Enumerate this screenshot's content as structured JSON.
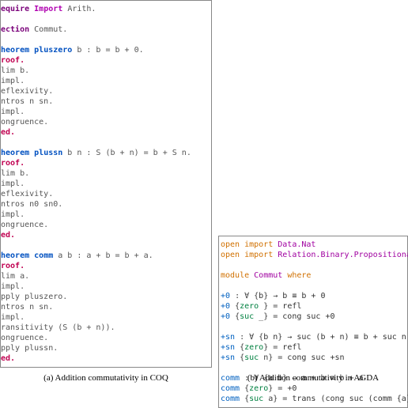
{
  "captions": {
    "a": "(a) Addition commutativity in COQ",
    "b": "(b) Addition commutativity in AGDA"
  },
  "coq": {
    "lines": [
      {
        "t": [
          [
            "cq-kw",
            "equire"
          ],
          [
            "cq-punct",
            " "
          ],
          [
            "cq-kw2",
            "Import"
          ],
          [
            "cq-punct",
            " "
          ],
          [
            "cq-body",
            "Arith."
          ]
        ]
      },
      {
        "t": [
          [
            "",
            ""
          ]
        ]
      },
      {
        "t": [
          [
            "cq-sec",
            "ection"
          ],
          [
            "cq-punct",
            " "
          ],
          [
            "cq-body",
            "Commut."
          ]
        ]
      },
      {
        "t": [
          [
            "",
            ""
          ]
        ]
      },
      {
        "t": [
          [
            "cq-thm",
            "heorem"
          ],
          [
            "cq-punct",
            " "
          ],
          [
            "cq-thm",
            "pluszero"
          ],
          [
            "cq-body",
            " b : b = b + 0."
          ]
        ]
      },
      {
        "t": [
          [
            "cq-proof",
            "roof."
          ]
        ]
      },
      {
        "t": [
          [
            "cq-body",
            "lim b."
          ]
        ]
      },
      {
        "t": [
          [
            "cq-body",
            "impl."
          ]
        ]
      },
      {
        "t": [
          [
            "cq-body",
            "eflexivity."
          ]
        ]
      },
      {
        "t": [
          [
            "cq-body",
            "ntros n sn."
          ]
        ]
      },
      {
        "t": [
          [
            "cq-body",
            "impl."
          ]
        ]
      },
      {
        "t": [
          [
            "cq-body",
            "ongruence."
          ]
        ]
      },
      {
        "t": [
          [
            "cq-qed",
            "ed."
          ]
        ]
      },
      {
        "t": [
          [
            "",
            ""
          ]
        ]
      },
      {
        "t": [
          [
            "cq-thm",
            "heorem"
          ],
          [
            "cq-punct",
            " "
          ],
          [
            "cq-thm",
            "plussn"
          ],
          [
            "cq-body",
            " b n : S (b + n) = b + S n."
          ]
        ]
      },
      {
        "t": [
          [
            "cq-proof",
            "roof."
          ]
        ]
      },
      {
        "t": [
          [
            "cq-body",
            "lim b."
          ]
        ]
      },
      {
        "t": [
          [
            "cq-body",
            "impl."
          ]
        ]
      },
      {
        "t": [
          [
            "cq-body",
            "eflexivity."
          ]
        ]
      },
      {
        "t": [
          [
            "cq-body",
            "ntros n0 sn0."
          ]
        ]
      },
      {
        "t": [
          [
            "cq-body",
            "impl."
          ]
        ]
      },
      {
        "t": [
          [
            "cq-body",
            "ongruence."
          ]
        ]
      },
      {
        "t": [
          [
            "cq-qed",
            "ed."
          ]
        ]
      },
      {
        "t": [
          [
            "",
            ""
          ]
        ]
      },
      {
        "t": [
          [
            "cq-thm",
            "heorem"
          ],
          [
            "cq-punct",
            " "
          ],
          [
            "cq-thm",
            "comm"
          ],
          [
            "cq-body",
            " a b : a + b = b + a."
          ]
        ]
      },
      {
        "t": [
          [
            "cq-proof",
            "roof."
          ]
        ]
      },
      {
        "t": [
          [
            "cq-body",
            "lim a."
          ]
        ]
      },
      {
        "t": [
          [
            "cq-body",
            "impl."
          ]
        ]
      },
      {
        "t": [
          [
            "cq-body",
            "pply pluszero."
          ]
        ]
      },
      {
        "t": [
          [
            "cq-body",
            "ntros n sn."
          ]
        ]
      },
      {
        "t": [
          [
            "cq-body",
            "impl."
          ]
        ]
      },
      {
        "t": [
          [
            "cq-body",
            "ransitivity (S (b + n))."
          ]
        ]
      },
      {
        "t": [
          [
            "cq-body",
            "ongruence."
          ]
        ]
      },
      {
        "t": [
          [
            "cq-body",
            "pply plussn."
          ]
        ]
      },
      {
        "t": [
          [
            "cq-qed",
            "ed."
          ]
        ]
      }
    ]
  },
  "agda": {
    "lines": [
      {
        "t": [
          [
            "ag-kw",
            "open import"
          ],
          [
            "ag-punct",
            " "
          ],
          [
            "ag-mod",
            "Data.Nat"
          ]
        ]
      },
      {
        "t": [
          [
            "ag-kw",
            "open import"
          ],
          [
            "ag-punct",
            " "
          ],
          [
            "ag-mod",
            "Relation.Binary.PropositionalEquality"
          ]
        ]
      },
      {
        "t": [
          [
            "",
            ""
          ]
        ]
      },
      {
        "t": [
          [
            "ag-kw",
            "module"
          ],
          [
            "ag-punct",
            " "
          ],
          [
            "ag-mod",
            "Commut"
          ],
          [
            "ag-punct",
            " "
          ],
          [
            "ag-kw",
            "where"
          ]
        ]
      },
      {
        "t": [
          [
            "",
            ""
          ]
        ]
      },
      {
        "t": [
          [
            "ag-id",
            "+0"
          ],
          [
            "ag-punct",
            " : ∀ {"
          ],
          [
            "ag-body",
            "b"
          ],
          [
            "ag-punct",
            "} → "
          ],
          [
            "ag-body",
            "b ≡ b + 0"
          ]
        ]
      },
      {
        "t": [
          [
            "ag-id",
            "+0"
          ],
          [
            "ag-punct",
            " {"
          ],
          [
            "ag-con",
            "zero"
          ],
          [
            "ag-punct",
            " } = "
          ],
          [
            "ag-body",
            "refl"
          ]
        ]
      },
      {
        "t": [
          [
            "ag-id",
            "+0"
          ],
          [
            "ag-punct",
            " {"
          ],
          [
            "ag-con",
            "suc"
          ],
          [
            "ag-punct",
            " _} = "
          ],
          [
            "ag-body",
            "cong suc +0"
          ]
        ]
      },
      {
        "t": [
          [
            "",
            ""
          ]
        ]
      },
      {
        "t": [
          [
            "ag-id",
            "+sn"
          ],
          [
            "ag-punct",
            " : ∀ {"
          ],
          [
            "ag-body",
            "b n"
          ],
          [
            "ag-punct",
            "} → "
          ],
          [
            "ag-body",
            "suc (b + n) ≡ b + suc n"
          ]
        ]
      },
      {
        "t": [
          [
            "ag-id",
            "+sn"
          ],
          [
            "ag-punct",
            " {"
          ],
          [
            "ag-con",
            "zero"
          ],
          [
            "ag-punct",
            "} = "
          ],
          [
            "ag-body",
            "refl"
          ]
        ]
      },
      {
        "t": [
          [
            "ag-id",
            "+sn"
          ],
          [
            "ag-punct",
            " {"
          ],
          [
            "ag-con",
            "suc"
          ],
          [
            "ag-punct",
            " n} = "
          ],
          [
            "ag-body",
            "cong suc +sn"
          ]
        ]
      },
      {
        "t": [
          [
            "",
            ""
          ]
        ]
      },
      {
        "t": [
          [
            "ag-id",
            "comm"
          ],
          [
            "ag-punct",
            " : ∀ {"
          ],
          [
            "ag-body",
            "a b"
          ],
          [
            "ag-punct",
            "} → "
          ],
          [
            "ag-body",
            "a + b ≡ b + a"
          ]
        ]
      },
      {
        "t": [
          [
            "ag-id",
            "comm"
          ],
          [
            "ag-punct",
            " {"
          ],
          [
            "ag-con",
            "zero"
          ],
          [
            "ag-punct",
            "} = "
          ],
          [
            "ag-body",
            "+0"
          ]
        ]
      },
      {
        "t": [
          [
            "ag-id",
            "comm"
          ],
          [
            "ag-punct",
            " {"
          ],
          [
            "ag-con",
            "suc"
          ],
          [
            "ag-punct",
            " a} = "
          ],
          [
            "ag-body",
            "trans (cong suc (comm {a})) +sn"
          ]
        ]
      }
    ]
  }
}
